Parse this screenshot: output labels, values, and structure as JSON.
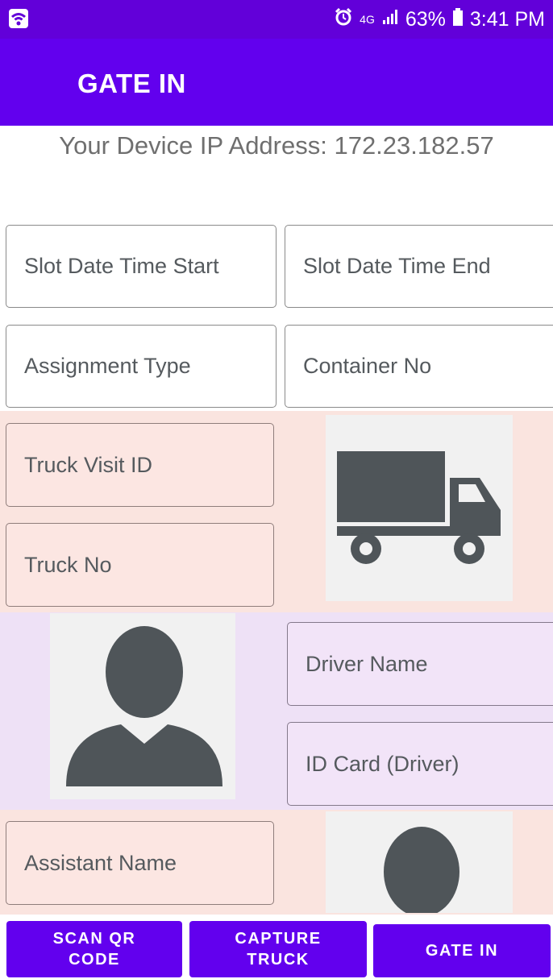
{
  "status_bar": {
    "network": "4G",
    "battery": "63%",
    "time": "3:41 PM"
  },
  "app_bar": {
    "title": "GATE IN"
  },
  "device_ip_text": "Your Device IP Address: 172.23.182.57",
  "fields": {
    "slot_start": "Slot Date Time Start",
    "slot_end": "Slot Date Time End",
    "assignment_type": "Assignment Type",
    "container_no": "Container No",
    "truck_visit_id": "Truck Visit ID",
    "truck_no": "Truck No",
    "driver_name": "Driver Name",
    "id_card_driver": "ID Card (Driver)",
    "assistant_name": "Assistant Name"
  },
  "buttons": {
    "scan_qr_code": "SCAN QR\nCODE",
    "capture_truck": "CAPTURE\nTRUCK",
    "gate_in": "GATE IN"
  },
  "icons": {
    "truck": "truck-icon",
    "driver": "person-icon",
    "assistant": "person-icon"
  },
  "colors": {
    "primary": "#6200ee",
    "status_bar": "#6200d9",
    "truck_section_bg": "#fae4df",
    "driver_section_bg": "#eee1f6",
    "icon_gray": "#4f5559"
  }
}
